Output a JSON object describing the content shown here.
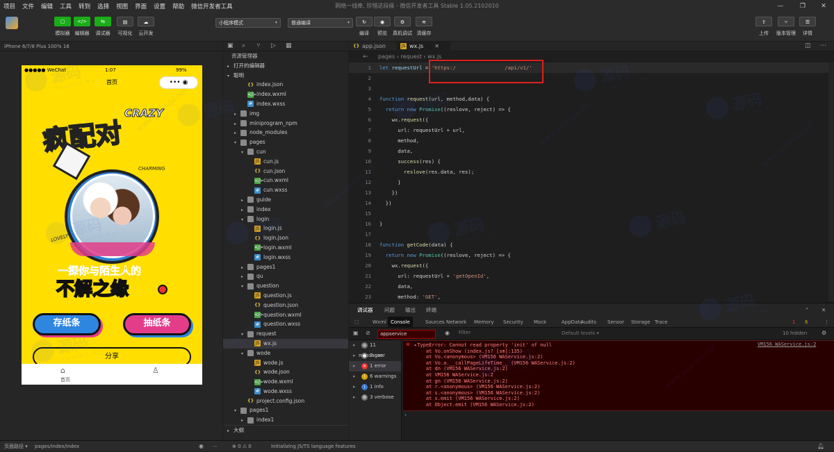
{
  "menu": [
    "项目",
    "文件",
    "编辑",
    "工具",
    "转到",
    "选择",
    "视图",
    "界面",
    "设置",
    "帮助",
    "微信开发者工具"
  ],
  "window_title": "网络一线牵, 珍惜这段缘 - 微信开发者工具 Stable 1.05.2102010",
  "toolbar": {
    "left_labels": [
      "模拟器",
      "编辑器",
      "调试器",
      "可视化",
      "云开发"
    ],
    "mode": "小程序模式",
    "compile": "普通编译",
    "mid_labels": [
      "编译",
      "预览",
      "真机调试",
      "清缓存"
    ],
    "right_labels": [
      "上传",
      "版本管理",
      "详情"
    ]
  },
  "simulator": {
    "device": "iPhone 6/7/8 Plus 100% 16",
    "status_left": "●●●●● WeChat",
    "status_time": "1:07",
    "status_right": "99%",
    "nav_title": "首页",
    "capsule": "••• ◉",
    "poster": {
      "crazy": "CRAZY",
      "title_art": "疯配对",
      "charming": "CHARMING",
      "lovely": "LOVELY",
      "line1": "一探你与陌生人的",
      "line2": "不解之缘",
      "btn_left": "存纸条",
      "btn_right": "抽纸条",
      "share": "分享"
    },
    "tab_home": "首页"
  },
  "explorer": {
    "header": "资源管理器",
    "open_editors": "打开的编辑器",
    "project": "聪明",
    "items": [
      {
        "d": 2,
        "t": "json",
        "n": "index.json"
      },
      {
        "d": 2,
        "t": "wxml",
        "n": "index.wxml"
      },
      {
        "d": 2,
        "t": "wxss",
        "n": "index.wxss"
      },
      {
        "d": 1,
        "t": "folder",
        "n": "img",
        "a": "▸"
      },
      {
        "d": 1,
        "t": "folder",
        "n": "miniprogram_npm",
        "a": "▸"
      },
      {
        "d": 1,
        "t": "folder",
        "n": "node_modules",
        "a": "▸"
      },
      {
        "d": 1,
        "t": "folder",
        "n": "pages",
        "a": "▾"
      },
      {
        "d": 2,
        "t": "folder",
        "n": "cun",
        "a": "▾"
      },
      {
        "d": 3,
        "t": "js",
        "n": "cun.js"
      },
      {
        "d": 3,
        "t": "json",
        "n": "cun.json"
      },
      {
        "d": 3,
        "t": "wxml",
        "n": "cun.wxml"
      },
      {
        "d": 3,
        "t": "wxss",
        "n": "cun.wxss"
      },
      {
        "d": 2,
        "t": "folder",
        "n": "guide",
        "a": "▸"
      },
      {
        "d": 2,
        "t": "folder",
        "n": "index",
        "a": "▸"
      },
      {
        "d": 2,
        "t": "folder",
        "n": "login",
        "a": "▾"
      },
      {
        "d": 3,
        "t": "js",
        "n": "login.js"
      },
      {
        "d": 3,
        "t": "json",
        "n": "login.json"
      },
      {
        "d": 3,
        "t": "wxml",
        "n": "login.wxml"
      },
      {
        "d": 3,
        "t": "wxss",
        "n": "login.wxss"
      },
      {
        "d": 2,
        "t": "folder",
        "n": "pages1",
        "a": "▸"
      },
      {
        "d": 2,
        "t": "folder",
        "n": "qu",
        "a": "▸"
      },
      {
        "d": 2,
        "t": "folder",
        "n": "question",
        "a": "▾"
      },
      {
        "d": 3,
        "t": "js",
        "n": "question.js"
      },
      {
        "d": 3,
        "t": "json",
        "n": "question.json"
      },
      {
        "d": 3,
        "t": "wxml",
        "n": "question.wxml"
      },
      {
        "d": 3,
        "t": "wxss",
        "n": "question.wxss"
      },
      {
        "d": 2,
        "t": "folder",
        "n": "request",
        "a": "▾"
      },
      {
        "d": 3,
        "t": "js",
        "n": "wx.js",
        "sel": true
      },
      {
        "d": 2,
        "t": "folder",
        "n": "wode",
        "a": "▾"
      },
      {
        "d": 3,
        "t": "js",
        "n": "wode.js"
      },
      {
        "d": 3,
        "t": "json",
        "n": "wode.json"
      },
      {
        "d": 3,
        "t": "wxml",
        "n": "wode.wxml"
      },
      {
        "d": 3,
        "t": "wxss",
        "n": "wode.wxss"
      },
      {
        "d": 2,
        "t": "json",
        "n": "project.config.json"
      },
      {
        "d": 1,
        "t": "folder",
        "n": "pages1",
        "a": "▾"
      },
      {
        "d": 2,
        "t": "folder",
        "n": "index1",
        "a": "▸"
      }
    ],
    "outline": "大纲"
  },
  "editor": {
    "tabs": [
      "app.json",
      "wx.js"
    ],
    "breadcrumb": "pages › request › wx.js",
    "lines": [
      [
        {
          "c": "kw",
          "t": "let "
        },
        {
          "c": "pr",
          "t": "requestUrl"
        },
        {
          "c": "",
          "t": " = "
        },
        {
          "c": "st",
          "t": "'https:/                /api/v1/'"
        }
      ],
      [],
      [],
      [
        {
          "c": "kw",
          "t": "function "
        },
        {
          "c": "fn",
          "t": "request"
        },
        {
          "c": "",
          "t": "(url, method,data) {"
        }
      ],
      [
        {
          "c": "",
          "t": "  "
        },
        {
          "c": "kw",
          "t": "return new "
        },
        {
          "c": "ar",
          "t": "Promise"
        },
        {
          "c": "",
          "t": "((reslove, reject) => {"
        }
      ],
      [
        {
          "c": "",
          "t": "    wx."
        },
        {
          "c": "fn",
          "t": "request"
        },
        {
          "c": "",
          "t": "({"
        }
      ],
      [
        {
          "c": "",
          "t": "      url: requestUrl + url,"
        }
      ],
      [
        {
          "c": "",
          "t": "      method,"
        }
      ],
      [
        {
          "c": "",
          "t": "      data,"
        }
      ],
      [
        {
          "c": "",
          "t": "      "
        },
        {
          "c": "fn",
          "t": "success"
        },
        {
          "c": "",
          "t": "(res) {"
        }
      ],
      [
        {
          "c": "",
          "t": "        "
        },
        {
          "c": "fn",
          "t": "reslove"
        },
        {
          "c": "",
          "t": "(res.data, res);"
        }
      ],
      [
        {
          "c": "",
          "t": "      }"
        }
      ],
      [
        {
          "c": "",
          "t": "    })"
        }
      ],
      [
        {
          "c": "",
          "t": "  })"
        }
      ],
      [],
      [
        {
          "c": "",
          "t": "}"
        }
      ],
      [],
      [
        {
          "c": "kw",
          "t": "function "
        },
        {
          "c": "fn",
          "t": "getCode"
        },
        {
          "c": "",
          "t": "(data) {"
        }
      ],
      [
        {
          "c": "",
          "t": "  "
        },
        {
          "c": "kw",
          "t": "return new "
        },
        {
          "c": "ar",
          "t": "Promise"
        },
        {
          "c": "",
          "t": "((reslove, reject) => {"
        }
      ],
      [
        {
          "c": "",
          "t": "    wx."
        },
        {
          "c": "fn",
          "t": "request"
        },
        {
          "c": "",
          "t": "({"
        }
      ],
      [
        {
          "c": "",
          "t": "      url: requestUrl + "
        },
        {
          "c": "st",
          "t": "'getOpenId'"
        },
        {
          "c": "",
          "t": ","
        }
      ],
      [
        {
          "c": "",
          "t": "      data,"
        }
      ],
      [
        {
          "c": "",
          "t": "      method: "
        },
        {
          "c": "st",
          "t": "'GET'"
        },
        {
          "c": "",
          "t": ","
        }
      ],
      [
        {
          "c": "",
          "t": "      "
        },
        {
          "c": "fn",
          "t": "success"
        },
        {
          "c": "",
          "t": "(res) {"
        }
      ]
    ]
  },
  "devtools": {
    "top_tabs": [
      "调试器",
      "问题",
      "输出",
      "终端"
    ],
    "panels": [
      "Wxml",
      "Console",
      "Sources",
      "Network",
      "Memory",
      "Security",
      "Mock",
      "AppData",
      "Audits",
      "Sensor",
      "Storage",
      "Trace"
    ],
    "context": "appservice",
    "filter": "Filter",
    "levels": "Default levels ▾",
    "hidden": "10 hidden",
    "err_count": "1",
    "warn_count": "6",
    "sidebar": [
      {
        "n": "11 messages",
        "c": "#777",
        "i": "≡"
      },
      {
        "n": "7 user mess...",
        "c": "#777",
        "i": "●"
      },
      {
        "n": "1 error",
        "c": "#e33",
        "i": "✕",
        "on": true
      },
      {
        "n": "6 warnings",
        "c": "#d9a400",
        "i": "!"
      },
      {
        "n": "1 info",
        "c": "#3a7bd5",
        "i": "i"
      },
      {
        "n": "3 verbose",
        "c": "#777",
        "i": "⚙"
      }
    ],
    "error_source": "VM156 WAService.js:2",
    "error_lines": [
      "▸TypeError: Cannot read property 'init' of null",
      "    at Vo.onShow (index.js? [sm]:135)",
      "    at Vo.<anonymous> (VM156 WAService.js:2)",
      "    at Vo.a.__callPageLifeTime__ (VM156 WAService.js:2)",
      "    at dn (VM156 WAService.js:2)",
      "    at VM156 WAService.js:2",
      "    at gn (VM156 WAService.js:2)",
      "    at r.<anonymous> (VM156 WAService.js:2)",
      "    at s.<anonymous> (VM156 WAService.js:2)",
      "    at s.emit (VM156 WAService.js:2)",
      "    at Object.emit (VM156 WAService.js:2)"
    ]
  },
  "bottom": {
    "path_label": "页面路径 ▾",
    "path": "pages/index/index",
    "status": "⊗ 0 ⚠ 0",
    "init": "Initializing JS/TS language features"
  },
  "watermark": "源码",
  "watermark2": "Y u a n D D . N e t",
  "watermark_url": "www.yuandd.net"
}
